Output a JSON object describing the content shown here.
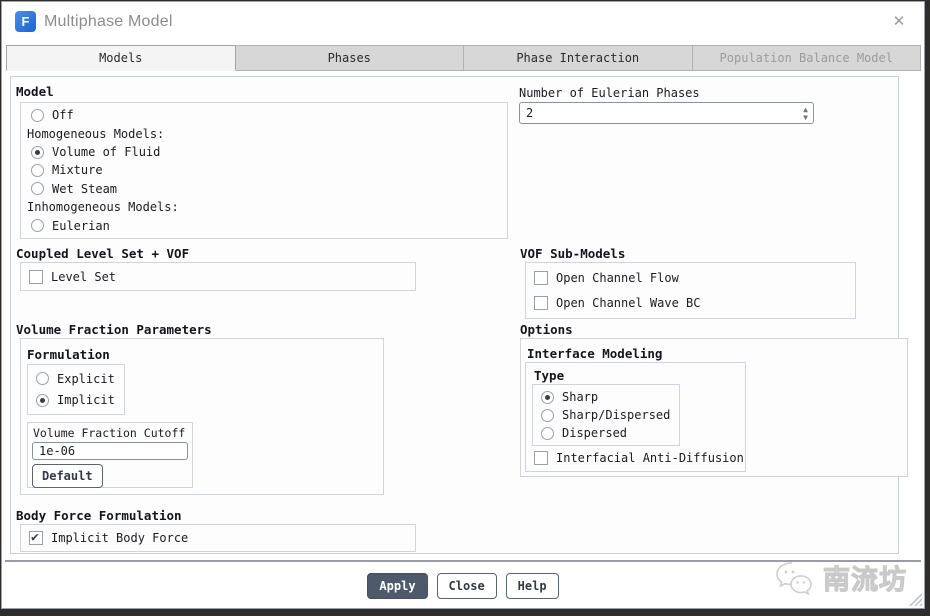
{
  "window": {
    "title": "Multiphase Model",
    "icon_letter": "F",
    "close_glyph": "✕"
  },
  "tabs": [
    {
      "label": "Models",
      "active": true,
      "enabled": true
    },
    {
      "label": "Phases",
      "active": false,
      "enabled": true
    },
    {
      "label": "Phase Interaction",
      "active": false,
      "enabled": true
    },
    {
      "label": "Population Balance Model",
      "active": false,
      "enabled": false
    }
  ],
  "model": {
    "title": "Model",
    "items": [
      {
        "type": "radio",
        "label": "Off",
        "checked": false
      },
      {
        "type": "label",
        "label": "Homogeneous Models:"
      },
      {
        "type": "radio",
        "label": "Volume of Fluid",
        "checked": true
      },
      {
        "type": "radio",
        "label": "Mixture",
        "checked": false
      },
      {
        "type": "radio",
        "label": "Wet Steam",
        "checked": false
      },
      {
        "type": "label",
        "label": "Inhomogeneous Models:"
      },
      {
        "type": "radio",
        "label": "Eulerian",
        "checked": false
      }
    ]
  },
  "eulerian_phases": {
    "label": "Number of Eulerian Phases",
    "value": "2"
  },
  "coupled": {
    "title": "Coupled Level Set + VOF",
    "items": [
      {
        "label": "Level Set",
        "checked": false
      }
    ]
  },
  "vof_submodels": {
    "title": "VOF Sub-Models",
    "items": [
      {
        "label": "Open Channel Flow",
        "checked": false
      },
      {
        "label": "Open Channel Wave BC",
        "checked": false
      }
    ]
  },
  "volume_fraction": {
    "title": "Volume Fraction Parameters",
    "formulation": {
      "title": "Formulation",
      "items": [
        {
          "label": "Explicit",
          "checked": false
        },
        {
          "label": "Implicit",
          "checked": true
        }
      ]
    },
    "cutoff": {
      "label": "Volume Fraction Cutoff",
      "value": "1e-06",
      "button": "Default"
    }
  },
  "options": {
    "title": "Options",
    "interface_modeling": {
      "title": "Interface Modeling",
      "type": {
        "title": "Type",
        "items": [
          {
            "label": "Sharp",
            "checked": true
          },
          {
            "label": "Sharp/Dispersed",
            "checked": false
          },
          {
            "label": "Dispersed",
            "checked": false
          }
        ]
      },
      "anti_diffusion": {
        "label": "Interfacial Anti-Diffusion",
        "checked": false
      }
    }
  },
  "body_force": {
    "title": "Body Force Formulation",
    "items": [
      {
        "label": "Implicit Body Force",
        "checked": true
      }
    ]
  },
  "buttons": {
    "apply": "Apply",
    "close": "Close",
    "help": "Help"
  },
  "watermark": {
    "text": "南流坊"
  },
  "colors": {
    "app_icon_blue": "#1b63cf",
    "apply_button": "#4e5a6c",
    "group_border": "#d0d4e0",
    "title_gray": "#8d8d8d",
    "separator": "#989da8"
  }
}
